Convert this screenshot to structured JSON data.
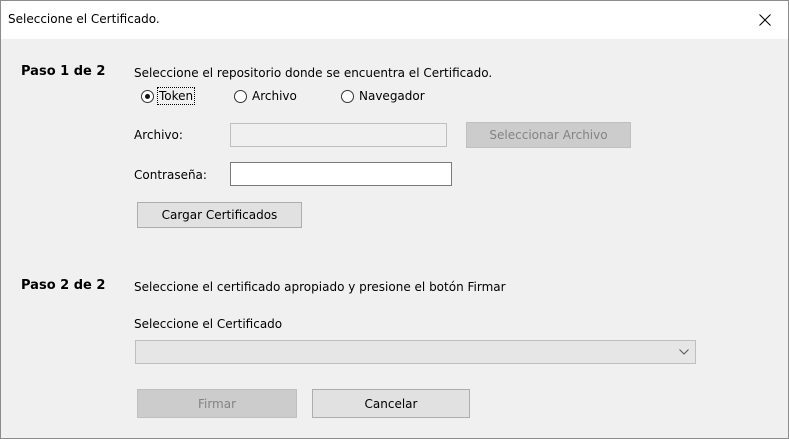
{
  "window": {
    "title": "Seleccione el Certificado.",
    "close_icon": "close-icon"
  },
  "step1": {
    "title": "Paso 1 de 2",
    "description": "Seleccione el repositorio donde se encuentra el Certificado.",
    "repo_options": [
      {
        "label": "Token",
        "checked": true
      },
      {
        "label": "Archivo",
        "checked": false
      },
      {
        "label": "Navegador",
        "checked": false
      }
    ],
    "file_label": "Archivo:",
    "file_value": "",
    "select_file_label": "Seleccionar Archivo",
    "password_label": "Contraseña:",
    "password_value": "",
    "load_label": "Cargar Certificados"
  },
  "step2": {
    "title": "Paso 2 de 2",
    "description": "Seleccione el certificado apropiado y presione el botón Firmar",
    "cert_label": "Seleccione el Certificado",
    "cert_selected": "",
    "sign_label": "Firmar",
    "cancel_label": "Cancelar"
  },
  "colors": {
    "dialog_bg": "#f0f0f0",
    "titlebar_bg": "#ffffff",
    "disabled_button": "#cccccc"
  }
}
